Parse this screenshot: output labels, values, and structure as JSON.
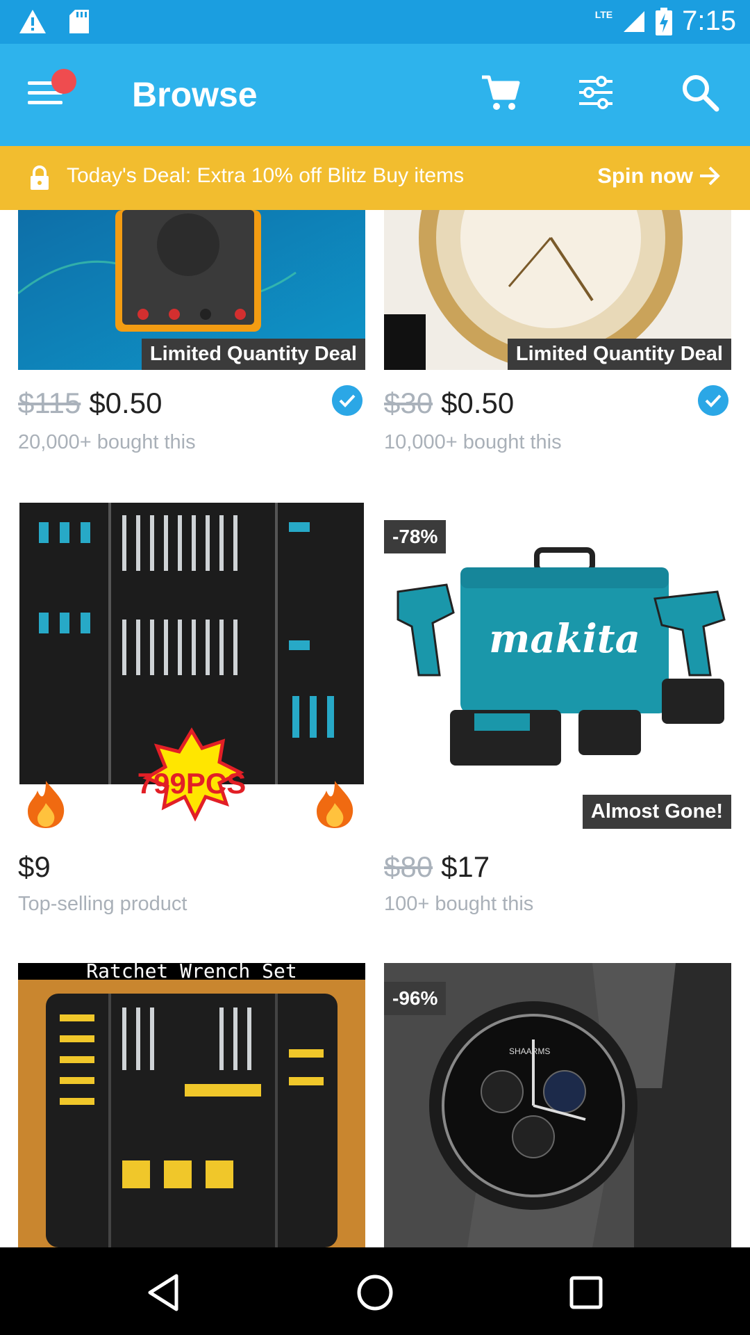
{
  "status_bar": {
    "time": "7:15",
    "network": "LTE"
  },
  "app_bar": {
    "title": "Browse"
  },
  "deal_banner": {
    "text": "Today's Deal: Extra 10% off Blitz Buy items",
    "action": "Spin now"
  },
  "products": [
    {
      "tag": "Limited Quantity Deal",
      "old_price": "$115",
      "price": "$0.50",
      "sub": "20,000+ bought this",
      "image": "multimeter"
    },
    {
      "tag": "Limited Quantity Deal",
      "old_price": "$30",
      "price": "$0.50",
      "sub": "10,000+ bought this",
      "image": "diamond watch"
    },
    {
      "badge": "799PCS",
      "price": "$9",
      "sub": "Top-selling product",
      "image": "tool set"
    },
    {
      "discount": "-78%",
      "tag": "Almost Gone!",
      "old_price": "$80",
      "price": "$17",
      "sub": "100+ bought this",
      "image": "makita drill kit",
      "brand": "makita"
    },
    {
      "caption": "Ratchet Wrench Set",
      "image": "ratchet wrench set"
    },
    {
      "discount": "-96%",
      "image": "black watch",
      "watch_brand": "SHAARMS"
    }
  ],
  "colors": {
    "primary": "#2eb3ec",
    "status": "#1b9ee0",
    "banner": "#f2bd2f",
    "badge_red": "#ef4c4f"
  }
}
